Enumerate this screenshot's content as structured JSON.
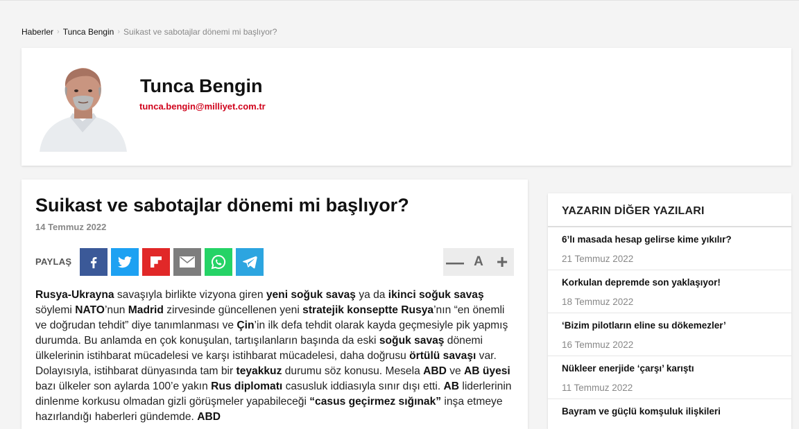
{
  "breadcrumb": {
    "items": [
      "Haberler",
      "Tunca Bengin",
      "Suikast ve sabotajlar dönemi mi başlıyor?"
    ]
  },
  "author": {
    "name": "Tunca Bengin",
    "email": "tunca.bengin@milliyet.com.tr"
  },
  "article": {
    "title": "Suikast ve sabotajlar dönemi mi başlıyor?",
    "date": "14 Temmuz 2022",
    "share_label": "PAYLAŞ",
    "share_buttons": [
      {
        "icon": "facebook-icon",
        "color": "#3b5998"
      },
      {
        "icon": "twitter-icon",
        "color": "#1da1f2"
      },
      {
        "icon": "flipboard-icon",
        "color": "#e12828"
      },
      {
        "icon": "email-icon",
        "color": "#7d7d7d"
      },
      {
        "icon": "whatsapp-icon",
        "color": "#25d366"
      },
      {
        "icon": "telegram-icon",
        "color": "#2ca5e0"
      }
    ],
    "font_controls": {
      "decrease": "—",
      "label": "A",
      "increase": "+"
    },
    "body_segments": [
      {
        "t": "Rusya-Ukrayna",
        "b": true
      },
      {
        "t": " savaşıyla birlikte vizyona giren ",
        "b": false
      },
      {
        "t": "yeni soğuk savaş",
        "b": true
      },
      {
        "t": " ya da ",
        "b": false
      },
      {
        "t": "ikinci soğuk savaş",
        "b": true
      },
      {
        "t": " söylemi ",
        "b": false
      },
      {
        "t": "NATO",
        "b": true
      },
      {
        "t": "’nun ",
        "b": false
      },
      {
        "t": "Madrid",
        "b": true
      },
      {
        "t": " zirvesinde güncellenen yeni ",
        "b": false
      },
      {
        "t": "stratejik konseptte Rusya",
        "b": true
      },
      {
        "t": "’nın “en önemli ve doğrudan tehdit” diye tanımlanması ve ",
        "b": false
      },
      {
        "t": "Çin",
        "b": true
      },
      {
        "t": "’in ilk defa tehdit olarak kayda geçmesiyle pik yapmış durumda. Bu anlamda en çok konuşulan, tartışılanların başında da eski ",
        "b": false
      },
      {
        "t": "soğuk savaş",
        "b": true
      },
      {
        "t": " dönemi ülkelerinin istihbarat mücadelesi ve karşı istihbarat mücadelesi, daha doğrusu ",
        "b": false
      },
      {
        "t": "örtülü savaşı",
        "b": true
      },
      {
        "t": " var. Dolayısıyla, istihbarat dünyasında tam bir ",
        "b": false
      },
      {
        "t": "teyakkuz",
        "b": true
      },
      {
        "t": " durumu söz konusu. Mesela ",
        "b": false
      },
      {
        "t": "ABD",
        "b": true
      },
      {
        "t": " ve ",
        "b": false
      },
      {
        "t": "AB üyesi",
        "b": true
      },
      {
        "t": " bazı ülkeler son aylarda 100’e yakın ",
        "b": false
      },
      {
        "t": "Rus diplomatı",
        "b": true
      },
      {
        "t": " casusluk iddiasıyla sınır dışı etti. ",
        "b": false
      },
      {
        "t": "AB",
        "b": true
      },
      {
        "t": " liderlerinin dinlenme korkusu olmadan gizli görüşmeler yapabileceği ",
        "b": false
      },
      {
        "t": "“casus geçirmez sığınak”",
        "b": true
      },
      {
        "t": " inşa etmeye hazırlandığı haberleri gündemde. ",
        "b": false
      },
      {
        "t": "ABD",
        "b": true
      }
    ]
  },
  "sidebar": {
    "title": "YAZARIN DİĞER YAZILARI",
    "posts": [
      {
        "title": "6’lı masada hesap gelirse kime yıkılır?",
        "date": "21 Temmuz 2022"
      },
      {
        "title": "Korkulan depremde son yaklaşıyor!",
        "date": "18 Temmuz 2022"
      },
      {
        "title": "‘Bizim pilotların eline su dökemezler’",
        "date": "16 Temmuz 2022"
      },
      {
        "title": "Nükleer enerjide ‘çarşı’ karıştı",
        "date": "11 Temmuz 2022"
      },
      {
        "title": "Bayram ve güçlü komşuluk ilişkileri",
        "date": ""
      }
    ]
  }
}
